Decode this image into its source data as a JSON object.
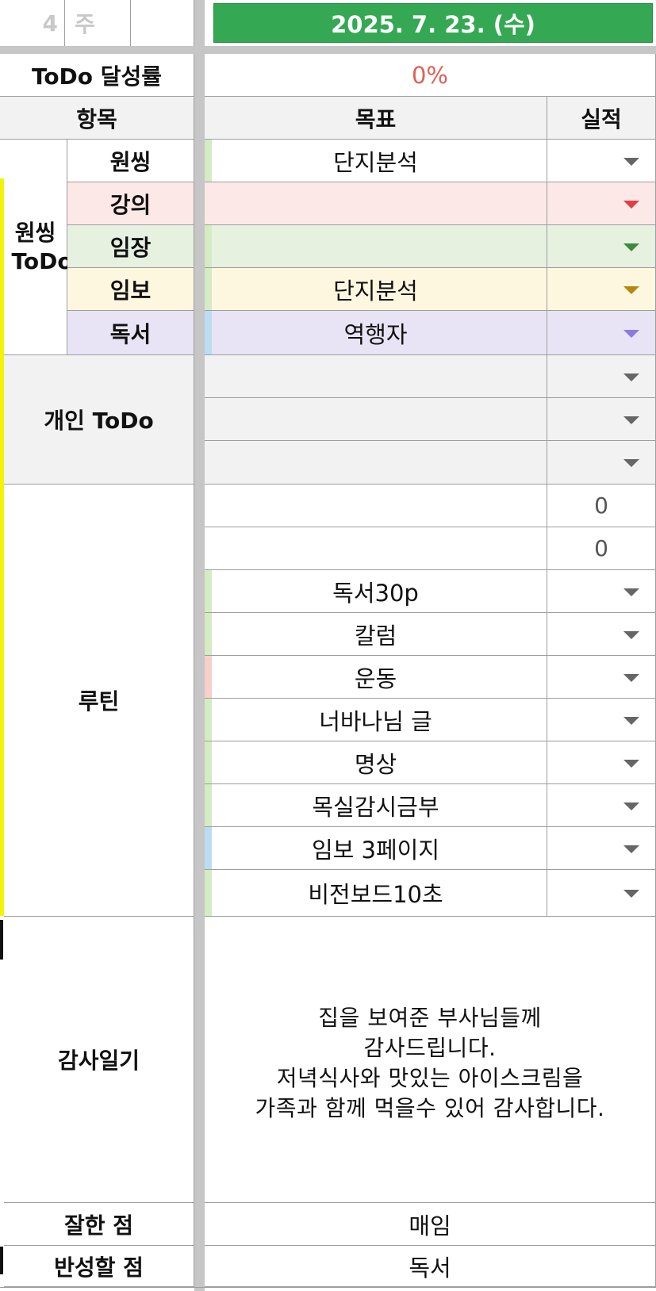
{
  "header": {
    "week_number": "4",
    "week_label": "주",
    "date": "2025. 7. 23. (수)"
  },
  "achievement": {
    "label": "ToDo 달성률",
    "value": "0%"
  },
  "columns": {
    "item": "항목",
    "goal": "목표",
    "result": "실적"
  },
  "wonssing": {
    "group_label": "원씽 ToDo",
    "rows": [
      {
        "label": "원씽",
        "goal": "단지분석"
      },
      {
        "label": "강의",
        "goal": ""
      },
      {
        "label": "임장",
        "goal": ""
      },
      {
        "label": "임보",
        "goal": "단지분석"
      },
      {
        "label": "독서",
        "goal": "역행자"
      }
    ]
  },
  "personal": {
    "label": "개인 ToDo",
    "rows": [
      {
        "goal": ""
      },
      {
        "goal": ""
      },
      {
        "goal": ""
      }
    ]
  },
  "routine": {
    "label": "루틴",
    "counter_rows": [
      {
        "goal": "",
        "result": "0"
      },
      {
        "goal": "",
        "result": "0"
      }
    ],
    "rows": [
      {
        "goal": "독서30p"
      },
      {
        "goal": "칼럼"
      },
      {
        "goal": "운동"
      },
      {
        "goal": "너바나님 글"
      },
      {
        "goal": "명상"
      },
      {
        "goal": "목실감시금부"
      },
      {
        "goal": "임보 3페이지"
      },
      {
        "goal": "비전보드10초"
      }
    ]
  },
  "gratitude": {
    "label": "감사일기",
    "lines": [
      "집을 보여준 부사님들께",
      "감사드립니다.",
      "저녁식사와 맛있는 아이스크림을",
      "가족과 함께 먹을수 있어 감사합니다."
    ]
  },
  "did_well": {
    "label": "잘한 점",
    "value": "매임"
  },
  "reflect": {
    "label": "반성할 점",
    "value": "독서"
  },
  "colors": {
    "header_green": "#34a853",
    "red_text": "#e06055",
    "pink": "#fce8e6",
    "green_row": "#e6f1e0",
    "yellow_row": "#fef7e0",
    "purple_row": "#e8e4f5",
    "side_yellow": "#f2f20a"
  }
}
